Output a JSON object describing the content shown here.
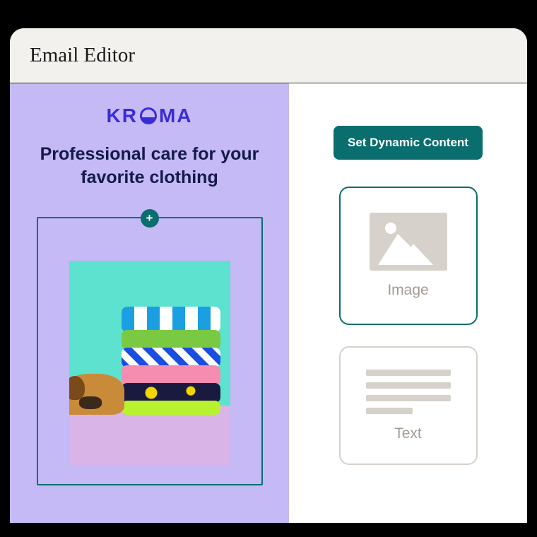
{
  "header": {
    "title": "Email Editor"
  },
  "canvas": {
    "brand_name": "KROMA",
    "headline": "Professional care for your favorite clothing"
  },
  "sidebar": {
    "dynamic_button_label": "Set Dynamic Content",
    "blocks": {
      "image_label": "Image",
      "text_label": "Text"
    }
  },
  "colors": {
    "accent": "#0a6e6e",
    "canvas_bg": "#c5b9f6",
    "brand": "#3a2cd6"
  }
}
